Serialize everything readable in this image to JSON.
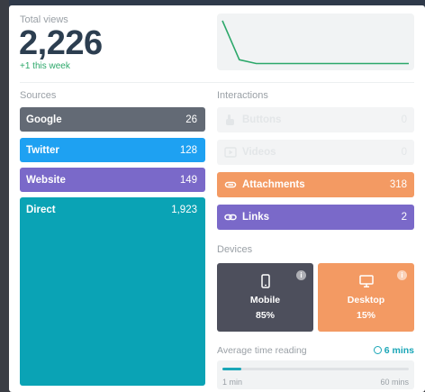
{
  "total_views": {
    "label": "Total views",
    "value": "2,226",
    "delta": "+1 this week"
  },
  "sparkline": {
    "color": "#2ca86a",
    "values": [
      60,
      8,
      3,
      3,
      3,
      3,
      3,
      3,
      3,
      3,
      3,
      3
    ]
  },
  "sources": {
    "label": "Sources",
    "items": [
      {
        "name": "Google",
        "count": "26",
        "color": "#636a75"
      },
      {
        "name": "Twitter",
        "count": "128",
        "color": "#1ea1f2"
      },
      {
        "name": "Website",
        "count": "149",
        "color": "#7a69c9"
      },
      {
        "name": "Direct",
        "count": "1,923",
        "color": "#0aa3b5"
      }
    ]
  },
  "interactions": {
    "label": "Interactions",
    "items": [
      {
        "name": "Buttons",
        "count": "0",
        "icon": "hand-pointer-icon",
        "color": "#f3f4f5",
        "muted": true
      },
      {
        "name": "Videos",
        "count": "0",
        "icon": "video-play-icon",
        "color": "#f3f4f5",
        "muted": true
      },
      {
        "name": "Attachments",
        "count": "318",
        "icon": "paperclip-icon",
        "color": "#f39a63",
        "muted": false
      },
      {
        "name": "Links",
        "count": "2",
        "icon": "link-icon",
        "color": "#7a69c9",
        "muted": false
      }
    ]
  },
  "devices": {
    "label": "Devices",
    "items": [
      {
        "name": "Mobile",
        "pct": "85%",
        "icon": "mobile-phone-icon",
        "color": "#4d4f5c"
      },
      {
        "name": "Desktop",
        "pct": "15%",
        "icon": "desktop-monitor-icon",
        "color": "#f39a63"
      }
    ]
  },
  "reading": {
    "label": "Average time reading",
    "value": "6 mins",
    "min_label": "1 min",
    "max_label": "60 mins",
    "progress_fraction": 0.1,
    "accent": "#1aa6b7"
  }
}
